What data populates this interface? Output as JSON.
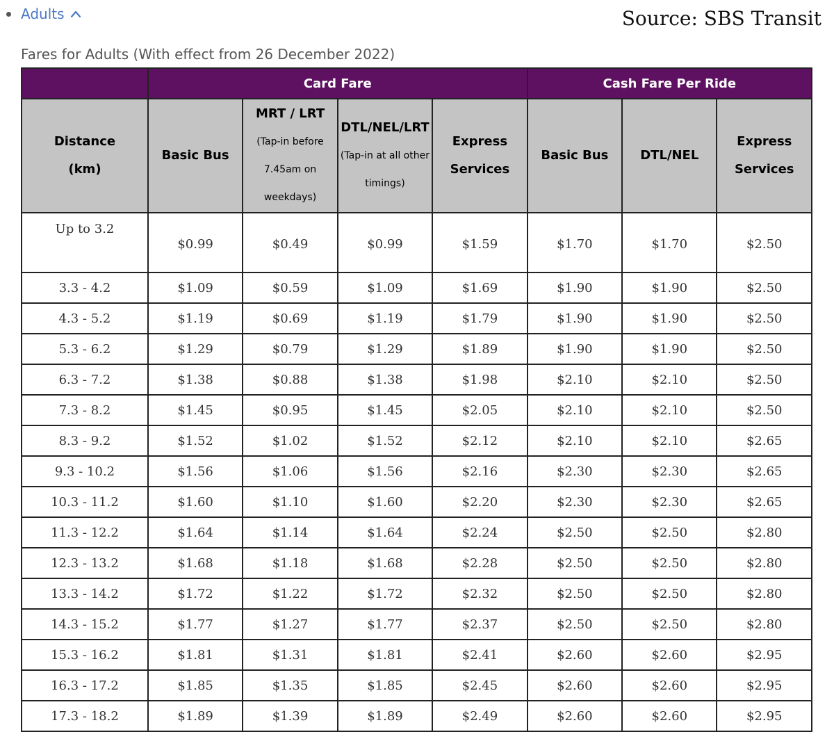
{
  "header": {
    "toggle_label": "Adults",
    "source": "Source: SBS Transit",
    "caption": "Fares for Adults (With effect from 26 December 2022)"
  },
  "table": {
    "groups": [
      "Card Fare",
      "Cash Fare Per Ride"
    ],
    "headers": {
      "distance_line1": "Distance",
      "distance_line2": "(km)",
      "basic_bus": "Basic Bus",
      "mrt_main": "MRT / LRT",
      "mrt_note1": "(Tap-in before",
      "mrt_note2": "7.45am on",
      "mrt_note3": "weekdays)",
      "dtl_main": "DTL/NEL/LRT",
      "dtl_note1": "(Tap-in at all other",
      "dtl_note2": "timings)",
      "express_line1": "Express",
      "express_line2": "Services",
      "cash_basic_bus": "Basic Bus",
      "cash_dtl": "DTL/NEL",
      "cash_express_line1": "Express",
      "cash_express_line2": "Services"
    },
    "rows": [
      [
        "Up to 3.2",
        "$0.99",
        "$0.49",
        "$0.99",
        "$1.59",
        "$1.70",
        "$1.70",
        "$2.50"
      ],
      [
        "3.3 - 4.2",
        "$1.09",
        "$0.59",
        "$1.09",
        "$1.69",
        "$1.90",
        "$1.90",
        "$2.50"
      ],
      [
        "4.3 - 5.2",
        "$1.19",
        "$0.69",
        "$1.19",
        "$1.79",
        "$1.90",
        "$1.90",
        "$2.50"
      ],
      [
        "5.3 - 6.2",
        "$1.29",
        "$0.79",
        "$1.29",
        "$1.89",
        "$1.90",
        "$1.90",
        "$2.50"
      ],
      [
        "6.3 - 7.2",
        "$1.38",
        "$0.88",
        "$1.38",
        "$1.98",
        "$2.10",
        "$2.10",
        "$2.50"
      ],
      [
        "7.3 - 8.2",
        "$1.45",
        "$0.95",
        "$1.45",
        "$2.05",
        "$2.10",
        "$2.10",
        "$2.50"
      ],
      [
        "8.3 - 9.2",
        "$1.52",
        "$1.02",
        "$1.52",
        "$2.12",
        "$2.10",
        "$2.10",
        "$2.65"
      ],
      [
        "9.3 - 10.2",
        "$1.56",
        "$1.06",
        "$1.56",
        "$2.16",
        "$2.30",
        "$2.30",
        "$2.65"
      ],
      [
        "10.3 - 11.2",
        "$1.60",
        "$1.10",
        "$1.60",
        "$2.20",
        "$2.30",
        "$2.30",
        "$2.65"
      ],
      [
        "11.3 - 12.2",
        "$1.64",
        "$1.14",
        "$1.64",
        "$2.24",
        "$2.50",
        "$2.50",
        "$2.80"
      ],
      [
        "12.3 - 13.2",
        "$1.68",
        "$1.18",
        "$1.68",
        "$2.28",
        "$2.50",
        "$2.50",
        "$2.80"
      ],
      [
        "13.3 - 14.2",
        "$1.72",
        "$1.22",
        "$1.72",
        "$2.32",
        "$2.50",
        "$2.50",
        "$2.80"
      ],
      [
        "14.3 - 15.2",
        "$1.77",
        "$1.27",
        "$1.77",
        "$2.37",
        "$2.50",
        "$2.50",
        "$2.80"
      ],
      [
        "15.3 - 16.2",
        "$1.81",
        "$1.31",
        "$1.81",
        "$2.41",
        "$2.60",
        "$2.60",
        "$2.95"
      ],
      [
        "16.3 - 17.2",
        "$1.85",
        "$1.35",
        "$1.85",
        "$2.45",
        "$2.60",
        "$2.60",
        "$2.95"
      ],
      [
        "17.3 - 18.2",
        "$1.89",
        "$1.39",
        "$1.89",
        "$2.49",
        "$2.60",
        "$2.60",
        "$2.95"
      ]
    ]
  },
  "colors": {
    "link": "#4a78c2",
    "band": "#5e1160",
    "header_bg": "#c4c4c4"
  },
  "icons": {
    "bullet": "bullet-dot-icon",
    "toggle": "chevron-up-icon"
  }
}
